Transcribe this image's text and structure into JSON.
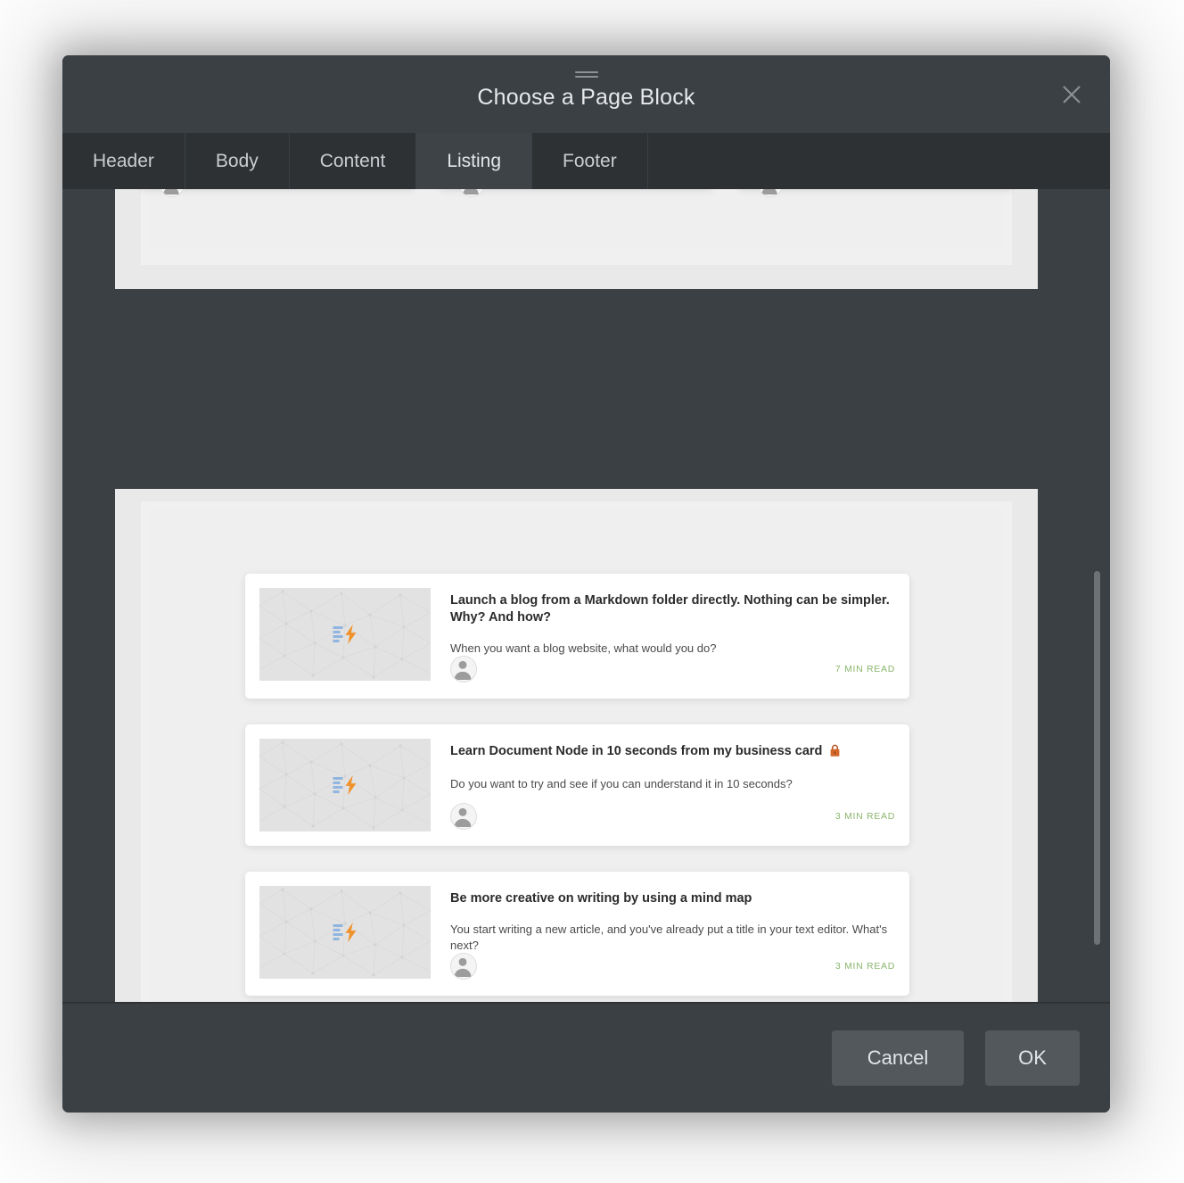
{
  "dialog": {
    "title": "Choose a Page Block",
    "close_icon": "close-icon",
    "drag_handle_icon": "drag-handle-icon"
  },
  "tabs": [
    {
      "label": "Header",
      "active": false
    },
    {
      "label": "Body",
      "active": false
    },
    {
      "label": "Content",
      "active": false
    },
    {
      "label": "Listing",
      "active": true
    },
    {
      "label": "Footer",
      "active": false
    }
  ],
  "preview": {
    "top_block": {
      "cards": [
        {
          "name": "top-card-1"
        },
        {
          "name": "top-card-2"
        },
        {
          "name": "top-card-3"
        }
      ]
    },
    "listing_block": {
      "articles": [
        {
          "title": "Launch a blog from a Markdown folder directly. Nothing can be simpler. Why? And how?",
          "description": "When you want a blog website, what would you do?",
          "read_time": "7 MIN READ",
          "locked": false,
          "thumb_icon": "document-lightning-icon",
          "avatar_icon": "user-avatar-icon"
        },
        {
          "title": "Learn Document Node in 10 seconds from my business card",
          "description": "Do you want to try and see if you can understand it in 10 seconds?",
          "read_time": "3 MIN READ",
          "locked": true,
          "lock_icon": "lock-icon",
          "thumb_icon": "document-lightning-icon",
          "avatar_icon": "user-avatar-icon"
        },
        {
          "title": "Be more creative on writing by using a mind map",
          "description": "You start writing a new article, and you've already put a title in your text editor. What's next?",
          "read_time": "3 MIN READ",
          "locked": false,
          "thumb_icon": "document-lightning-icon",
          "avatar_icon": "user-avatar-icon"
        }
      ]
    }
  },
  "footer": {
    "cancel_label": "Cancel",
    "ok_label": "OK"
  },
  "colors": {
    "dialog_bg": "#3b4044",
    "tabstrip_bg": "#2d3134",
    "tab_active_bg": "#3d4347",
    "title_text": "#e6e8ea",
    "panel_bg": "#e9e9e9",
    "card_bg": "#ffffff",
    "read_time_green": "#8ab66e",
    "bolt_orange": "#f0922b",
    "bars_blue": "#8fb5e0",
    "lock_orange": "#c4571f",
    "button_bg": "#53585c"
  },
  "scrollbar": {
    "orientation": "vertical",
    "thumb_top_pct": 47,
    "thumb_height_pct": 46
  }
}
